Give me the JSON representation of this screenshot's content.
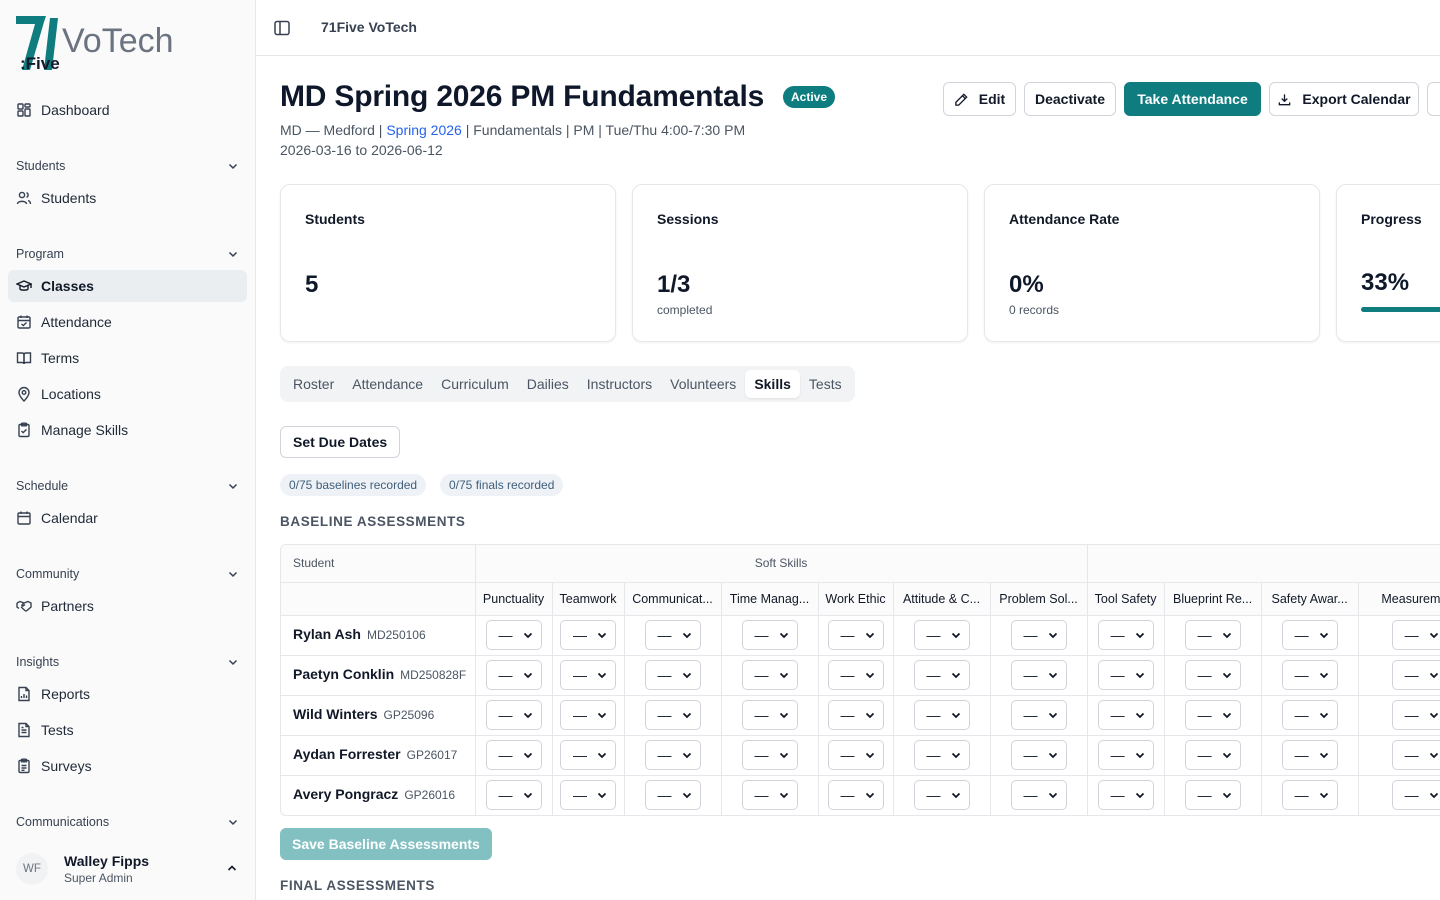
{
  "app": {
    "logo": {
      "number": "71",
      "word": "VoTech",
      "sub": ":Five"
    },
    "breadcrumb": "71Five VoTech"
  },
  "sidebar": {
    "dashboard": "Dashboard",
    "groups": {
      "students": "Students",
      "program": "Program",
      "schedule": "Schedule",
      "community": "Community",
      "insights": "Insights",
      "communications": "Communications"
    },
    "items": {
      "students": "Students",
      "classes": "Classes",
      "attendance": "Attendance",
      "terms": "Terms",
      "locations": "Locations",
      "manage_skills": "Manage Skills",
      "calendar": "Calendar",
      "partners": "Partners",
      "reports": "Reports",
      "tests": "Tests",
      "surveys": "Surveys"
    },
    "active_item": "Classes",
    "user": {
      "initials": "WF",
      "name": "Walley Fipps",
      "role": "Super Admin"
    }
  },
  "header": {
    "title": "MD Spring 2026 PM Fundamentals",
    "status_badge": "Active",
    "meta_prefix": "MD — Medford | ",
    "meta_link": "Spring 2026",
    "meta_suffix": " | Fundamentals | PM | Tue/Thu 4:00-7:30 PM",
    "date_range": "2026-03-16 to 2026-06-12",
    "actions": {
      "edit": "Edit",
      "deactivate": "Deactivate",
      "take_attendance": "Take Attendance",
      "export_calendar": "Export Calendar"
    }
  },
  "stats": {
    "students": {
      "label": "Students",
      "value": "5"
    },
    "sessions": {
      "label": "Sessions",
      "value": "1/3",
      "sub": "completed"
    },
    "attendance_rate": {
      "label": "Attendance Rate",
      "value": "0%",
      "sub": "0 records"
    },
    "progress": {
      "label": "Progress",
      "value": "33%",
      "fraction": 0.33
    }
  },
  "tabs": [
    "Roster",
    "Attendance",
    "Curriculum",
    "Dailies",
    "Instructors",
    "Volunteers",
    "Skills",
    "Tests"
  ],
  "active_tab": "Skills",
  "skills": {
    "set_due_dates": "Set Due Dates",
    "baselines_recorded": "0/75 baselines recorded",
    "finals_recorded": "0/75 finals recorded",
    "baseline_heading": "BASELINE ASSESSMENTS",
    "final_heading": "FINAL ASSESSMENTS",
    "save_baseline": "Save Baseline Assessments",
    "table": {
      "student_header": "Student",
      "group_label": "Soft Skills",
      "columns": [
        "Punctuality",
        "Teamwork",
        "Communication",
        "Time Management",
        "Work Ethic",
        "Attitude & Conduct",
        "Problem Solving",
        "Tool Safety",
        "Blueprint Reading",
        "Safety Awareness",
        "Measurement"
      ],
      "column_display": [
        "Punctuality",
        "Teamwork",
        "Communicat...",
        "Time Manag...",
        "Work Ethic",
        "Attitude & C...",
        "Problem Sol...",
        "Tool Safety",
        "Blueprint Re...",
        "Safety Awar...",
        "Measureme..."
      ],
      "empty_value": "—",
      "rows": [
        {
          "name": "Rylan Ash",
          "id": "MD250106"
        },
        {
          "name": "Paetyn Conklin",
          "id": "MD250828F"
        },
        {
          "name": "Wild Winters",
          "id": "GP25096"
        },
        {
          "name": "Aydan Forrester",
          "id": "GP26017"
        },
        {
          "name": "Avery Pongracz",
          "id": "GP26016"
        }
      ]
    }
  },
  "colors": {
    "accent": "#0f7c80",
    "link": "#2563eb"
  }
}
